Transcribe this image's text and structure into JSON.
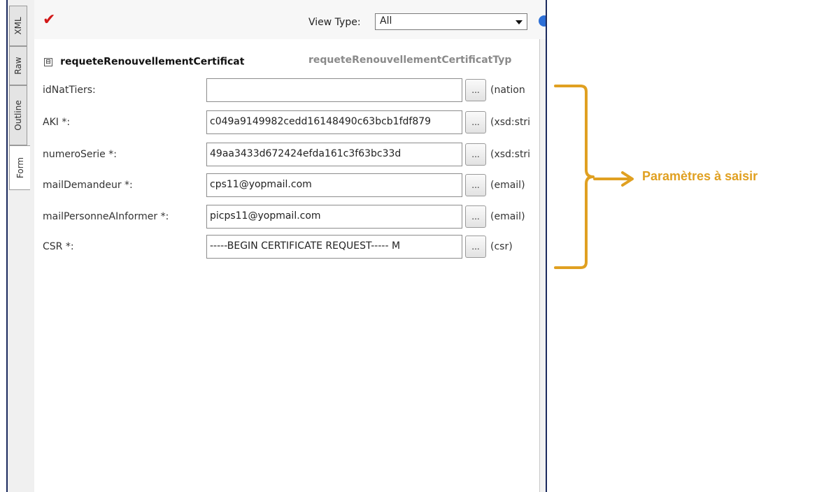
{
  "side_tabs": [
    "XML",
    "Raw",
    "Outline",
    "Form"
  ],
  "toolbar": {
    "view_type_label": "View Type:",
    "view_type_value": "All",
    "validate_icon": "check-icon",
    "help_icon": "help-icon"
  },
  "form": {
    "element_name": "requeteRenouvellementCertificat",
    "element_type": "requeteRenouvellementCertificatTyp",
    "fields": [
      {
        "label": "idNatTiers:",
        "value": "",
        "type_hint": "(nation"
      },
      {
        "label": "AKI *:",
        "value": "c049a9149982cedd16148490c63bcb1fdf879",
        "type_hint": "(xsd:stri"
      },
      {
        "label": "numeroSerie *:",
        "value": "49aa3433d672424efda161c3f63bc33d",
        "type_hint": "(xsd:stri"
      },
      {
        "label": "mailDemandeur *:",
        "value": "cps11@yopmail.com",
        "type_hint": "(email)"
      },
      {
        "label": "mailPersonneAInformer *:",
        "value": "picps11@yopmail.com",
        "type_hint": "(email)"
      },
      {
        "label": "CSR *:",
        "value": "-----BEGIN CERTIFICATE REQUEST----- M",
        "type_hint": "(csr)"
      }
    ],
    "ellipsis_label": "..."
  },
  "annotation": {
    "text": "Paramètres à saisir",
    "color": "#e0a021"
  }
}
